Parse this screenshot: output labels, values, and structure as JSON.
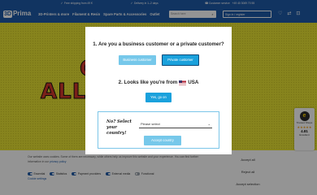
{
  "topbar": {
    "shipping": "Free shipping from 49 €",
    "delivery": "Delivery in 1–2 days",
    "phone": "+49 40 3069 70 55",
    "service": "Customer service"
  },
  "header": {
    "logo_badge": "3D",
    "logo_text": "Prima",
    "nav": [
      "3D-Printers & more",
      "Filament & Resin",
      "Spare Parts & Accessories",
      "Outlet"
    ],
    "search_placeholder": "Search here",
    "account_label": "Sign in / register"
  },
  "hero": {
    "line1": "ON",
    "line2": "ALL"
  },
  "modal": {
    "question1": "1. Are you a business customer or a private customer?",
    "business_btn": "Business customer",
    "private_btn": "Private customer",
    "question2_prefix": "2. Looks like you're from",
    "country": "USA",
    "go_btn": "Yes, go on",
    "not_label": "No? Select your country!",
    "select_value": "Please select",
    "accept_btn": "Accept country"
  },
  "cookie": {
    "text": "Our website uses cookies. Some of them are necessary, while others help us improve this website and your experience. You can find further information in our",
    "link": "privacy policy",
    "toggles": [
      {
        "label": "Essential",
        "on": true
      },
      {
        "label": "Statistics",
        "on": true
      },
      {
        "label": "Payment providers",
        "on": true
      },
      {
        "label": "External media",
        "on": true
      },
      {
        "label": "Functional",
        "on": false
      }
    ],
    "functional_link": "Cookie settings",
    "accept_all": "Accept all",
    "reject_all": "Reject all",
    "accept_selection": "Accept selection"
  },
  "trusted": {
    "seal": "e",
    "title": "Trusted Shops",
    "stars": "★★★★★",
    "score": "4.81",
    "rating_word": "Excellent"
  },
  "colors": {
    "brand_blue": "#1e5aa8",
    "button_blue": "#1aa1dc",
    "button_light": "#76c8ea",
    "hero_yellow": "#e8e332",
    "hero_red": "#d33a2b"
  }
}
